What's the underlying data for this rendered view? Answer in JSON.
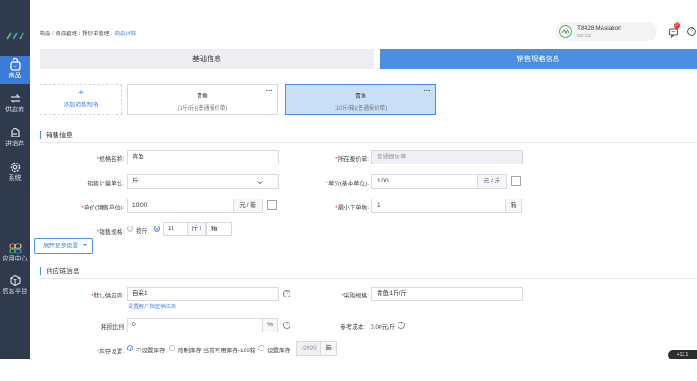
{
  "sidebar": {
    "items": [
      {
        "label": "商品",
        "icon": "shopping-bag-icon"
      },
      {
        "label": "供应商",
        "icon": "exchange-icon"
      },
      {
        "label": "进销存",
        "icon": "inventory-icon"
      },
      {
        "label": "系统",
        "icon": "gear-icon"
      },
      {
        "label": "应用中心",
        "icon": "app-center-icon"
      },
      {
        "label": "信息平台",
        "icon": "cube-icon"
      }
    ]
  },
  "header": {
    "breadcrumb": [
      "商品",
      "商品管理",
      "报价单管理",
      "商品详情"
    ],
    "user_name": "T8428 MAsiation",
    "user_sub": "ozccsz",
    "badge": "5",
    "help": "?"
  },
  "tabs": {
    "basic": "基础信息",
    "sales": "销售规格信息"
  },
  "specs": {
    "add_label": "添加销售规格",
    "add_plus": "+",
    "cards": [
      {
        "name": "青鱼",
        "desc": "(1斤/斤)(普通报价单)",
        "more": "···"
      },
      {
        "name": "青鱼",
        "desc": "(10斤/箱)(普通报价单)",
        "more": "···"
      }
    ]
  },
  "sales_info": {
    "title": "销售信息",
    "spec_name_label": "规格名称:",
    "spec_name_value": "青鱼",
    "quote_label": "所在报价单:",
    "quote_value": "普通报价单",
    "unit_label": "销售计量单位:",
    "unit_value": "斤",
    "base_price_label": "单价(基本单位):",
    "base_price_value": "1.00",
    "base_price_unit": "元 / 斤",
    "sale_price_label": "单价(销售单位):",
    "sale_price_value": "10.00",
    "sale_price_unit": "元 / 箱",
    "min_order_label": "最小下单数:",
    "min_order_value": "1",
    "min_order_unit": "箱",
    "sale_spec_label": "销售规格:",
    "option_by_jin": "按斤",
    "spec_qty": "10",
    "spec_unit1": "斤 /",
    "spec_unit2": "箱",
    "expand_label": "展开更多设置"
  },
  "supply_info": {
    "title": "供应链信息",
    "supplier_label": "默认供应商:",
    "supplier_value": "自采1",
    "supplier_link": "设置客户指定供应商",
    "purchase_spec_label": "采购规格:",
    "purchase_spec_value": "青鱼|1斤/斤",
    "loss_label": "耗损比例",
    "loss_value": "0",
    "loss_unit": "%",
    "ref_cost_label": "参考成本:",
    "ref_cost_value": "0.00元/斤",
    "stock_label": "库存设置:",
    "stock_opt1": "不设置库存",
    "stock_opt2": "限制库存 当前可用库存-100箱",
    "stock_opt3": "设置库存",
    "stock_value": "-9999",
    "stock_unit": "箱"
  },
  "zoom": "+13.1"
}
